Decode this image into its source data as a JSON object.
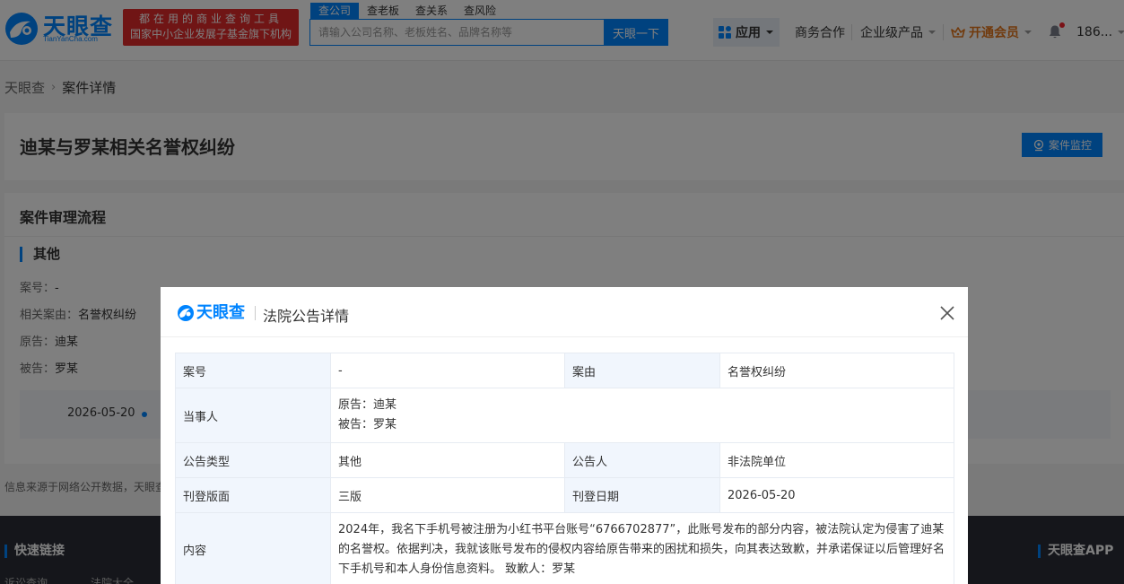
{
  "header": {
    "logo_text": "天眼查",
    "logo_sub": "TianYanCha.com",
    "slogan_line1": "都在用的商业查询工具",
    "slogan_line2": "国家中小企业发展子基金旗下机构",
    "search_tabs": [
      "查公司",
      "查老板",
      "查关系",
      "查风险"
    ],
    "search_placeholder": "请输入公司名称、老板姓名、品牌名称等",
    "search_button": "天眼一下",
    "nav": {
      "apps": "应用",
      "business": "商务合作",
      "enterprise": "企业级产品",
      "vip": "开通会员",
      "user": "186..."
    }
  },
  "breadcrumb": {
    "home": "天眼查",
    "current": "案件详情"
  },
  "case": {
    "title": "迪某与罗某相关名誉权纠纷",
    "monitor_button": "案件监控"
  },
  "flow": {
    "section_title": "案件审理流程",
    "sub_title": "其他",
    "case_no_label": "案号：",
    "case_no_value": "-",
    "cause_label": "相关案由：",
    "cause_value": "名誉权纠纷",
    "plaintiff_label": "原告：",
    "plaintiff_value": "迪某",
    "defendant_label": "被告：",
    "defendant_value": "罗某",
    "timeline_date": "2026-05-20"
  },
  "disclaimer": "信息来源于网络公开数据，天眼查",
  "footer": {
    "quick_links_title": "快速链接",
    "app_title": "天眼查APP",
    "links": [
      "诉讼查询",
      "法院大全"
    ]
  },
  "modal": {
    "logo_text": "天眼查",
    "title": "法院公告详情",
    "rows": {
      "case_no_label": "案号",
      "case_no_value": "-",
      "cause_label": "案由",
      "cause_value": "名誉权纠纷",
      "parties_label": "当事人",
      "party_plaintiff": "原告：迪某",
      "party_defendant": "被告：罗某",
      "type_label": "公告类型",
      "type_value": "其他",
      "publisher_label": "公告人",
      "publisher_value": "非法院单位",
      "layout_label": "刊登版面",
      "layout_value": "三版",
      "date_label": "刊登日期",
      "date_value": "2026-05-20",
      "content_label": "内容",
      "content_value": "2024年，我名下手机号被注册为小红书平台账号“6766702877”，此账号发布的部分内容，被法院认定为侵害了迪某的名誉权。依据判决，我就该账号发布的侵权内容给原告带来的困扰和损失，向其表达致歉，并承诺保证以后管理好名下手机号和本人身份信息资料。 致歉人：罗某"
    }
  }
}
